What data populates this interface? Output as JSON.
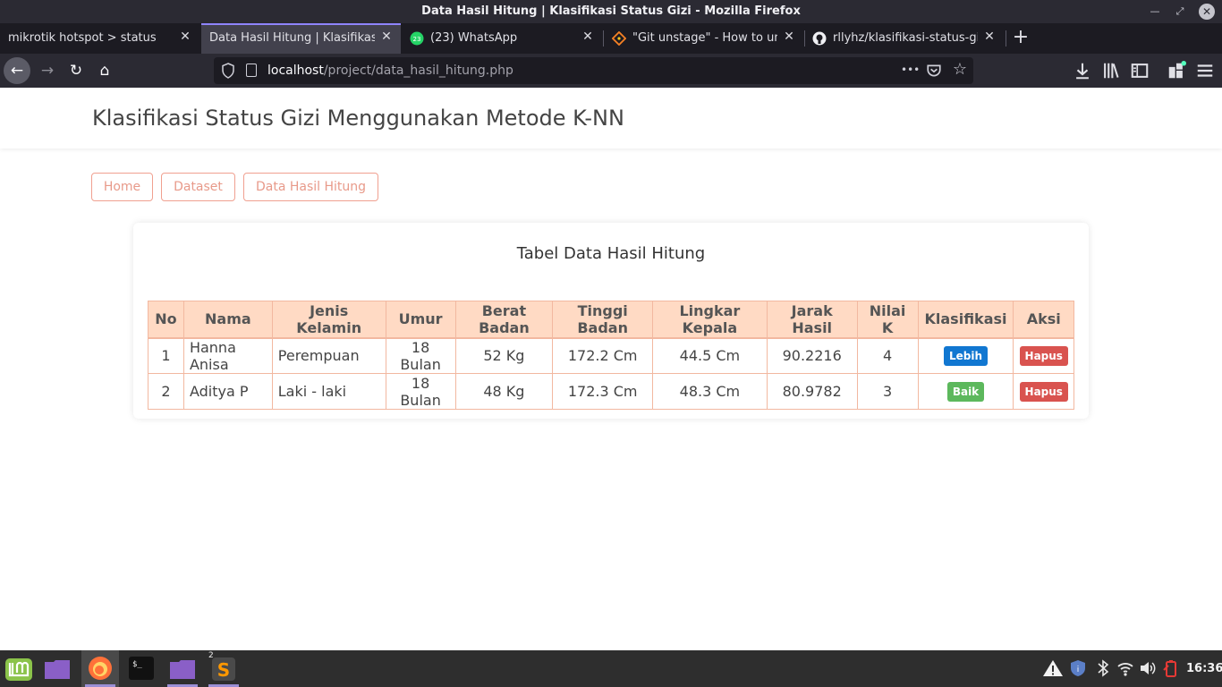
{
  "window": {
    "title": "Data Hasil Hitung | Klasifikasi Status Gizi - Mozilla Firefox",
    "minimize": "—",
    "maximize": "⤢",
    "close": "✕"
  },
  "tabs": [
    {
      "label": "mikrotik hotspot > status",
      "icon": "none"
    },
    {
      "label": "Data Hasil Hitung | Klasifikasi S",
      "icon": "none",
      "active": true
    },
    {
      "label": "(23) WhatsApp",
      "icon": "whatsapp-icon",
      "badge": "23"
    },
    {
      "label": "\"Git unstage\" - How to unst",
      "icon": "git-icon"
    },
    {
      "label": "rllyhz/klasifikasi-status-gizi",
      "icon": "github-icon"
    }
  ],
  "tab_close": "✕",
  "new_tab": "+",
  "nav": {
    "back": "←",
    "forward": "→",
    "reload": "↻",
    "home": "⌂",
    "url_host": "localhost",
    "url_path": "/project/data_hasil_hitung.php",
    "more": "•••",
    "pocket": "◡",
    "bookmark": "☆",
    "download": "⤓",
    "library": "𝄃𝄃\\",
    "sidebar": "▤",
    "extensions": "⊞",
    "menu": "≡"
  },
  "site": {
    "title": "Klasifikasi Status Gizi Menggunakan Metode K-NN",
    "menu": [
      "Home",
      "Dataset",
      "Data Hasil Hitung"
    ]
  },
  "card": {
    "title": "Tabel Data Hasil Hitung"
  },
  "table": {
    "headers": [
      "No",
      "Nama",
      "Jenis\nKelamin",
      "Umur",
      "Berat\nBadan",
      "Tinggi\nBadan",
      "Lingkar\nKepala",
      "Jarak\nHasil",
      "Nilai\nK",
      "Klasifikasi",
      "Aksi"
    ],
    "rows": [
      {
        "no": "1",
        "nama": "Hanna Anisa",
        "jenis_kelamin": "Perempuan",
        "umur": "18 Bulan",
        "berat": "52 Kg",
        "tinggi": "172.2 Cm",
        "lingkar": "44.5 Cm",
        "jarak": "90.2216",
        "k": "4",
        "klasifikasi": "Lebih",
        "klasifikasi_color": "#1177d1",
        "aksi": "Hapus"
      },
      {
        "no": "2",
        "nama": "Aditya P",
        "jenis_kelamin": "Laki - laki",
        "umur": "18 Bulan",
        "berat": "48 Kg",
        "tinggi": "172.3 Cm",
        "lingkar": "48.3 Cm",
        "jarak": "80.9782",
        "k": "3",
        "klasifikasi": "Baik",
        "klasifikasi_color": "#5cb85c",
        "aksi": "Hapus"
      }
    ]
  },
  "taskbar": {
    "apps": [
      "mint-menu-icon",
      "files-icon",
      "firefox-icon",
      "terminal-icon",
      "folder-icon",
      "sublime-text-icon"
    ],
    "sublime_count": "2",
    "clock": "16:36"
  }
}
